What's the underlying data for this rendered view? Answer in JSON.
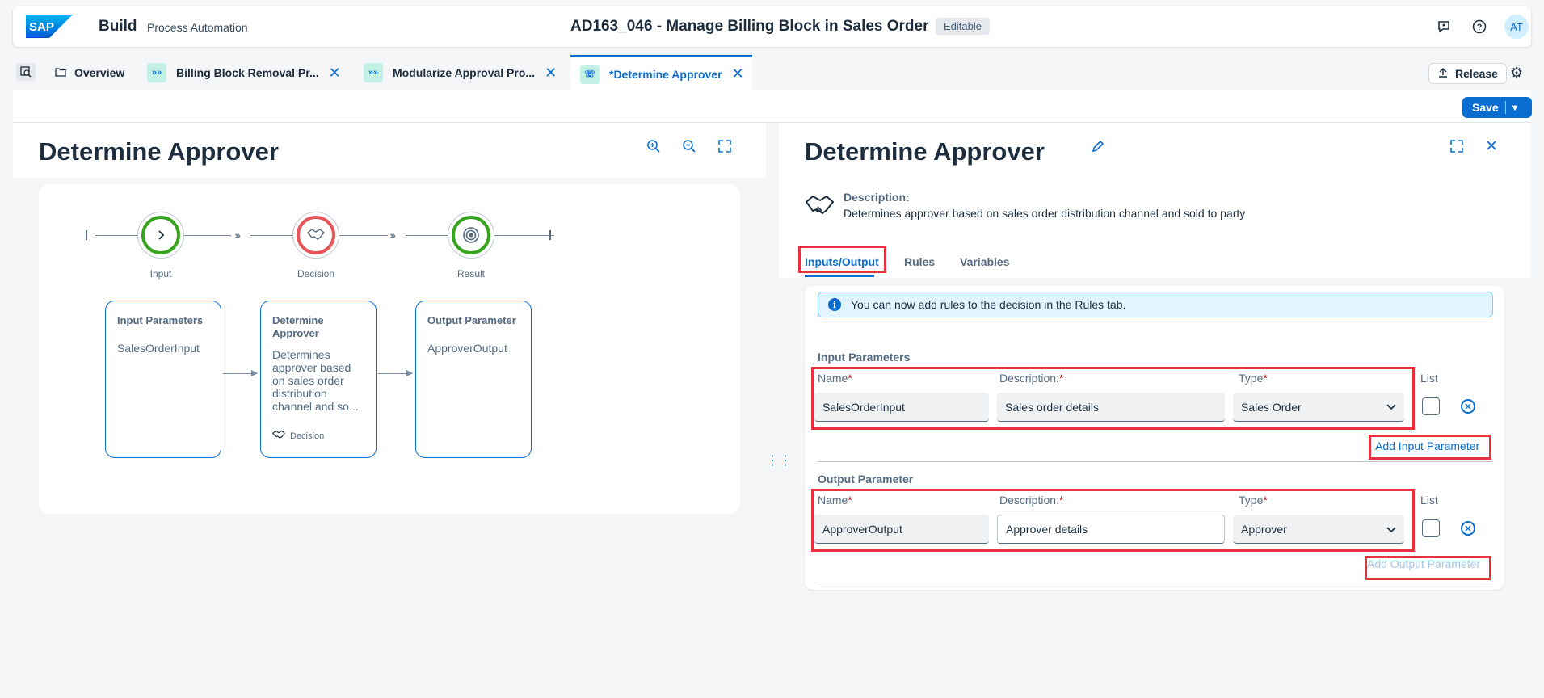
{
  "shell": {
    "logo_text": "SAP",
    "brand": "Build",
    "product": "Process Automation",
    "title": "AD163_046 - Manage Billing Block in Sales Order",
    "status_badge": "Editable",
    "avatar_initials": "AT"
  },
  "tabs": [
    {
      "label": "Overview",
      "icon": "folder-icon"
    },
    {
      "label": "Billing Block Removal Pr...",
      "icon": "process-icon",
      "closable": true
    },
    {
      "label": "Modularize Approval Pro...",
      "icon": "process-icon",
      "closable": true
    },
    {
      "label": "*Determine Approver",
      "icon": "decision-icon",
      "closable": true,
      "active": true
    }
  ],
  "toolbar": {
    "release_label": "Release",
    "save_label": "Save"
  },
  "canvas": {
    "title": "Determine Approver",
    "nodes": [
      {
        "label": "Input",
        "color": "#36a41d"
      },
      {
        "label": "Decision",
        "color": "#e95458"
      },
      {
        "label": "Result",
        "color": "#36a41d"
      }
    ],
    "cards": [
      {
        "title": "Input Parameters",
        "value": "SalesOrderInput"
      },
      {
        "title": "Determine Approver",
        "value": "Determines approver based on sales order distribution channel and so...",
        "footer": "Decision"
      },
      {
        "title": "Output Parameter",
        "value": "ApproverOutput"
      }
    ]
  },
  "detail": {
    "title": "Determine Approver",
    "description_label": "Description:",
    "description": "Determines approver based on sales order distribution channel and sold to party",
    "tabs": [
      "Inputs/Output",
      "Rules",
      "Variables"
    ],
    "active_tab": "Inputs/Output",
    "info_message": "You can now add rules to the decision in the Rules tab.",
    "input_section": "Input Parameters",
    "output_section": "Output Parameter",
    "labels": {
      "name": "Name",
      "description": "Description:",
      "type": "Type",
      "list": "List",
      "required": "*"
    },
    "input_param": {
      "name": "SalesOrderInput",
      "description": "Sales order details",
      "type": "Sales Order",
      "list": false
    },
    "output_param": {
      "name": "ApproverOutput",
      "description": "Approver details",
      "type": "Approver",
      "list": false
    },
    "add_input_label": "Add Input Parameter",
    "add_output_label": "Add Output Parameter"
  },
  "colors": {
    "accent": "#0a6ed1",
    "highlight": "#e5323f"
  }
}
